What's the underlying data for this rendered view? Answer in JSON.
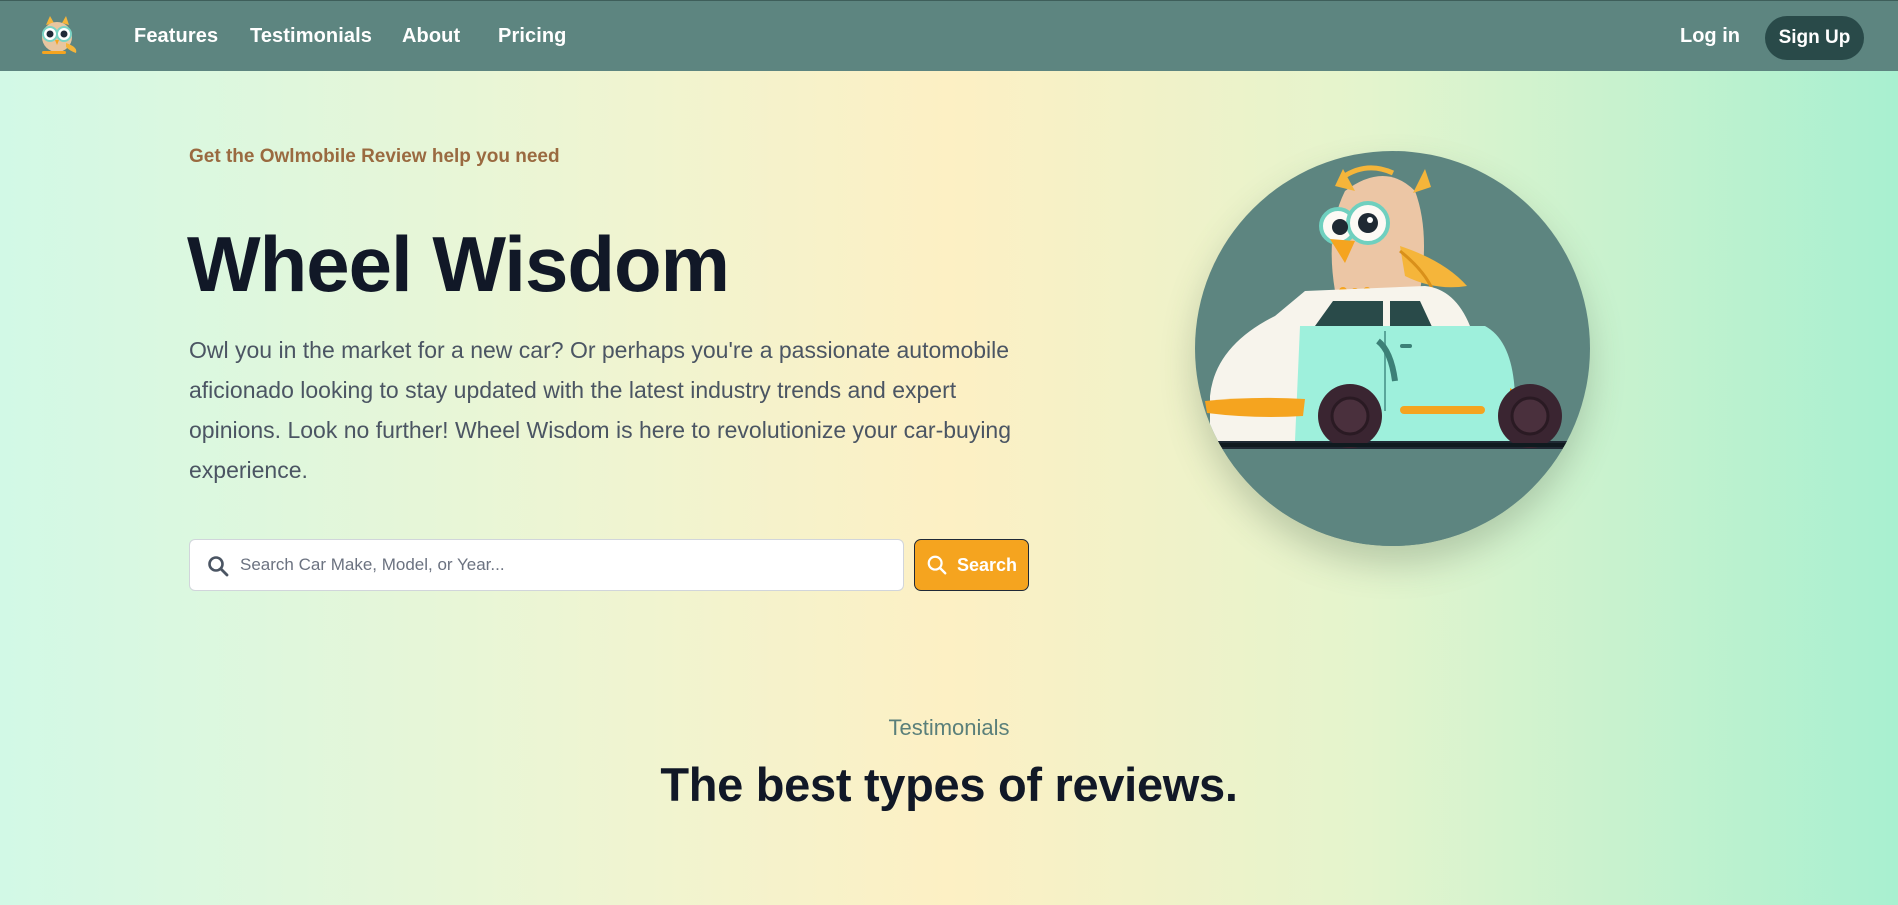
{
  "nav": {
    "logo_icon": "owl-logo-icon",
    "links": [
      "Features",
      "Testimonials",
      "About",
      "Pricing"
    ],
    "login_label": "Log in",
    "signup_label": "Sign Up",
    "bg_color": "#5d8580"
  },
  "hero": {
    "eyebrow": "Get the Owlmobile Review help you need",
    "title": "Wheel Wisdom",
    "description": "Owl you in the market for a new car? Or perhaps you're a passionate automobile aficionado looking to stay updated with the latest industry trends and expert opinions. Look no further! Wheel Wisdom is here to revolutionize your car-buying experience.",
    "search_placeholder": "Search Car Make, Model, or Year...",
    "search_button_label": "Search",
    "search_icon": "search-icon",
    "image_icon": "owl-on-car-illustration",
    "accent_color": "#f5a41f"
  },
  "testimonials": {
    "label": "Testimonials",
    "title": "The best types of reviews."
  }
}
